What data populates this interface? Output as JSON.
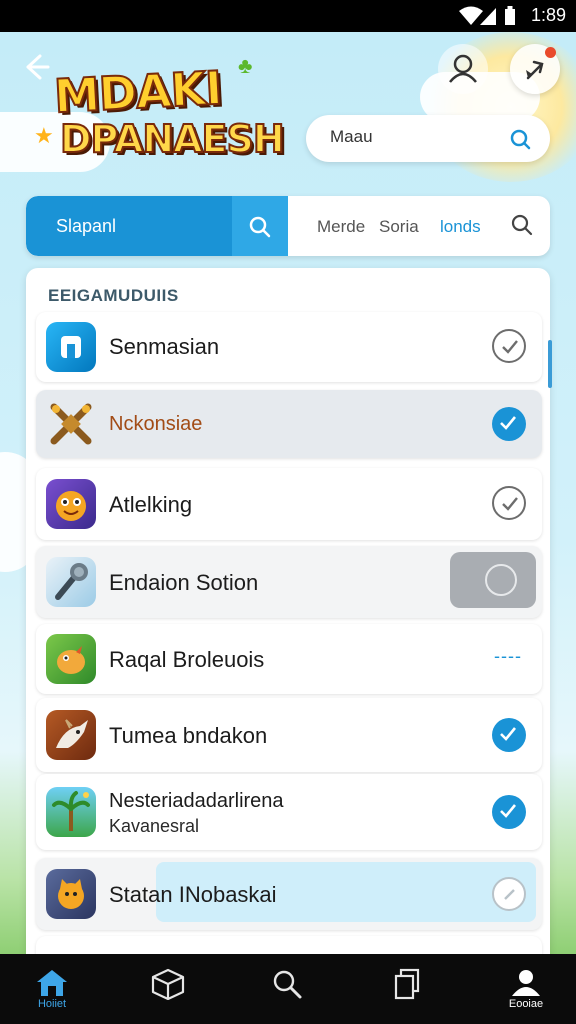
{
  "status_bar": {
    "time": "1:89"
  },
  "header": {
    "logo_line1": "MDAKI",
    "logo_line2": "DPANAESH",
    "search_value": "Maau",
    "search_placeholder": ""
  },
  "tabs": {
    "active_label": "Slapanl",
    "items": [
      {
        "label": "Merde"
      },
      {
        "label": "Soria"
      },
      {
        "label": "londs",
        "selected": true
      }
    ]
  },
  "list": {
    "title": "EEIGAMUDUIIS",
    "items": [
      {
        "name": "Senmasian",
        "icon": "app-icon-blue",
        "state": "unchecked"
      },
      {
        "name": "Nckonsiae",
        "icon": "crossed-swords-icon",
        "state": "checked"
      },
      {
        "name": "Atlelking",
        "icon": "smiley-monster-icon",
        "state": "unchecked"
      },
      {
        "name": "Endaion Sotion",
        "icon": "microphone-icon",
        "state": "toggle"
      },
      {
        "name": "Raqal Broleuois",
        "icon": "green-dino-icon",
        "state": "pending"
      },
      {
        "name": "Tumea bndakon",
        "icon": "unicorn-icon",
        "state": "checked"
      },
      {
        "name": "Nesteriadadarlirena",
        "sub": "Kavanesral",
        "icon": "palm-tree-icon",
        "state": "checked"
      },
      {
        "name": "Statan INobaskai",
        "icon": "cat-hero-icon",
        "state": "unchecked"
      }
    ],
    "pending_text": "----"
  },
  "bottom_nav": {
    "items": [
      {
        "label": "Hoiiet",
        "icon": "home-icon",
        "active": true
      },
      {
        "label": "",
        "icon": "cube-icon"
      },
      {
        "label": "",
        "icon": "search-icon"
      },
      {
        "label": "",
        "icon": "copy-icon"
      },
      {
        "label": "Eooiae",
        "icon": "profile-icon"
      }
    ]
  },
  "colors": {
    "accent": "#1a93d6",
    "nav_bg": "#0b0b0b"
  }
}
